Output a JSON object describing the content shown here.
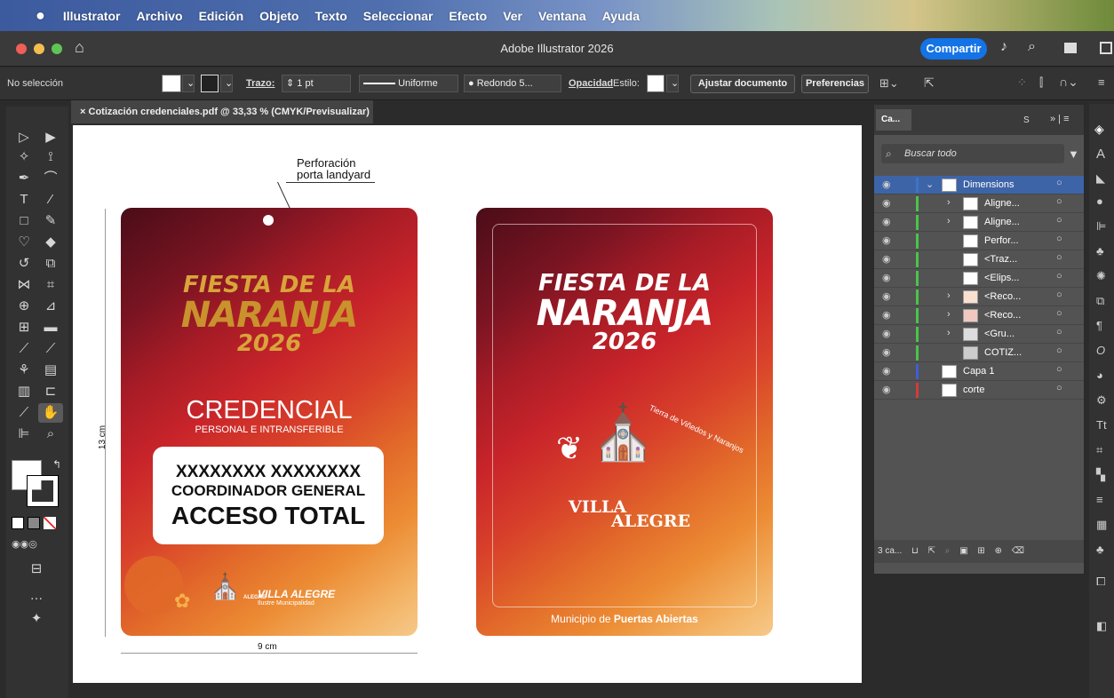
{
  "menubar": {
    "apple": "",
    "app": "Illustrator",
    "items": [
      "Archivo",
      "Edición",
      "Objeto",
      "Texto",
      "Seleccionar",
      "Efecto",
      "Ver",
      "Ventana",
      "Ayuda"
    ]
  },
  "window": {
    "title": "Adobe Illustrator 2026",
    "share": "Compartir"
  },
  "control": {
    "selection": "No selección",
    "stroke_label": "Trazo:",
    "stroke_value": "1 pt",
    "profile": "Uniforme",
    "brush": "Redondo 5...",
    "opacity": "Opacidad",
    "style": "Estilo:",
    "adjust": "Ajustar documento",
    "prefs": "Preferencias"
  },
  "document": {
    "tab": "Cotización credenciales.pdf @ 33,33 % (CMYK/Previsualizar)",
    "close": "×"
  },
  "artboard": {
    "annotation_line1": "Perforación",
    "annotation_line2": "porta landyard",
    "height_label": "13 cm",
    "width_label": "9 cm",
    "front": {
      "fiesta": "FIESTA DE LA",
      "naranja": "NARANJA",
      "year": "2026",
      "credencial": "CREDENCIAL",
      "personal": "PERSONAL E INTRANSFERIBLE",
      "name": "XXXXXXXX XXXXXXXX",
      "role": "COORDINADOR GENERAL",
      "access": "ACCESO TOTAL",
      "brand": "VILLA ALEGRE",
      "brand_sub": "Ilustre Municipalidad",
      "crest": "ALEGRE"
    },
    "back": {
      "fiesta": "FIESTA DE LA",
      "naranja": "NARANJA",
      "year": "2026",
      "villa": "VILLA",
      "alegre": "ALEGRE",
      "motto": "Tierra de Viñedos y Naranjos",
      "footer_a": "Municipio de ",
      "footer_b": "Puertas Abiertas"
    }
  },
  "layers": {
    "tab": "Ca...",
    "tab2": "S",
    "search": "Buscar todo",
    "count": "3 ca...",
    "rows": [
      {
        "name": "Dimensions",
        "color": "#3f73c9"
      },
      {
        "name": "Aligne...",
        "color": "#4ac44a"
      },
      {
        "name": "Aligne...",
        "color": "#4ac44a"
      },
      {
        "name": "Perfor...",
        "color": "#4ac44a"
      },
      {
        "name": "<Traz...",
        "color": "#4ac44a"
      },
      {
        "name": "<Elips...",
        "color": "#4ac44a"
      },
      {
        "name": "<Reco...",
        "color": "#4ac44a"
      },
      {
        "name": "<Reco...",
        "color": "#4ac44a"
      },
      {
        "name": "<Gru...",
        "color": "#4ac44a"
      },
      {
        "name": "COTIZ...",
        "color": "#4ac44a"
      },
      {
        "name": "Capa 1",
        "color": "#3f5ed6"
      },
      {
        "name": "corte",
        "color": "#d13c3c"
      }
    ]
  },
  "colors": {
    "accent": "#1473e6",
    "card_dark": "#5a1020",
    "card_red": "#c8242a",
    "card_orange": "#e97a2a",
    "card_light": "#f2b264"
  }
}
